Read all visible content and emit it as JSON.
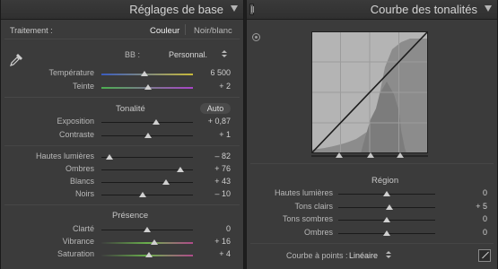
{
  "basic_panel": {
    "title": "Réglages de base",
    "treatment_label": "Traitement :",
    "treatment_options": [
      "Couleur",
      "Noir/blanc"
    ],
    "wb_label": "BB :",
    "wb_value": "Personnal.",
    "tone_title": "Tonalité",
    "auto_label": "Auto",
    "presence_title": "Présence",
    "sliders": [
      {
        "label": "Température",
        "value": "6 500",
        "position": 0.47
      },
      {
        "label": "Teinte",
        "value": "+ 2",
        "position": 0.51
      },
      {
        "label": "Exposition",
        "value": "+ 0,87",
        "position": 0.6
      },
      {
        "label": "Contraste",
        "value": "+ 1",
        "position": 0.51
      },
      {
        "label": "Hautes lumières",
        "value": "– 82",
        "position": 0.09
      },
      {
        "label": "Ombres",
        "value": "+ 76",
        "position": 0.86
      },
      {
        "label": "Blancs",
        "value": "+ 43",
        "position": 0.71
      },
      {
        "label": "Noirs",
        "value": "– 10",
        "position": 0.45
      },
      {
        "label": "Clarté",
        "value": "0",
        "position": 0.5
      },
      {
        "label": "Vibrance",
        "value": "+ 16",
        "position": 0.58
      },
      {
        "label": "Saturation",
        "value": "+ 4",
        "position": 0.52
      }
    ]
  },
  "curve_panel": {
    "title": "Courbe des tonalités",
    "region_title": "Région",
    "sliders": [
      {
        "label": "Hautes lumières",
        "value": "0",
        "position": 0.5
      },
      {
        "label": "Tons clairs",
        "value": "+ 5",
        "position": 0.525
      },
      {
        "label": "Tons sombres",
        "value": "0",
        "position": 0.5
      },
      {
        "label": "Ombres",
        "value": "0",
        "position": 0.5
      }
    ],
    "point_curve_label": "Courbe à points :",
    "point_curve_value": "Linéaire"
  }
}
